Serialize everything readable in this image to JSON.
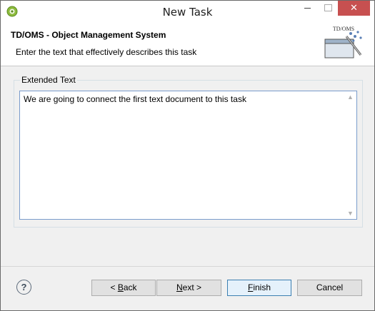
{
  "window": {
    "title": "New Task",
    "close_symbol": "✕"
  },
  "header": {
    "title": "TD/OMS - Object Management System",
    "description": "Enter the text that effectively describes this task",
    "logo_text": "TD/OMS"
  },
  "group": {
    "label": "Extended Text"
  },
  "extended_text": {
    "value": "We are going to connect the first text document to this task"
  },
  "buttons": {
    "help": "?",
    "back_prefix": "< ",
    "back_mnemonic": "B",
    "back_rest": "ack",
    "next_mnemonic": "N",
    "next_rest": "ext >",
    "finish_mnemonic": "F",
    "finish_rest": "inish",
    "cancel": "Cancel"
  },
  "icons": {
    "app": "app-icon",
    "help": "help-icon",
    "scroll_up": "chevron-up-icon",
    "scroll_down": "chevron-down-icon"
  },
  "colors": {
    "close_button": "#c75050",
    "textarea_border": "#7a9ccc",
    "default_button_border": "#3c7fb1"
  }
}
